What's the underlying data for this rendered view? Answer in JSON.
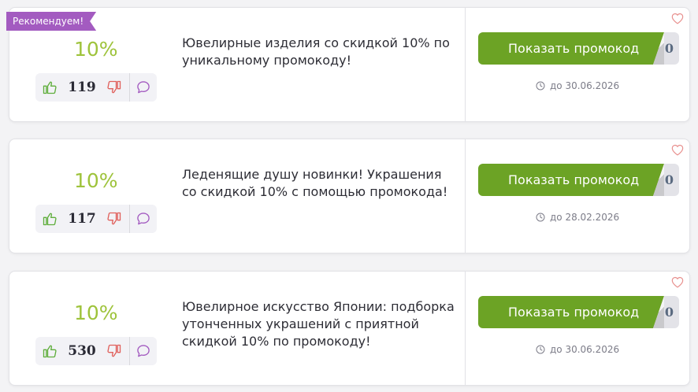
{
  "offers": [
    {
      "badge": "Рекомендуем!",
      "discount": "10%",
      "votes": "119",
      "description": "Ювелирные изделия со скидкой 10% по уникальному промокоду!",
      "button_label": "Показать промокод",
      "uses": "0",
      "expiry": "до 30.06.2026"
    },
    {
      "discount": "10%",
      "votes": "117",
      "description": "Леденящие душу новинки! Украшения со скидкой 10% с помощью промокода!",
      "button_label": "Показать промокод",
      "uses": "0",
      "expiry": "до 28.02.2026"
    },
    {
      "discount": "10%",
      "votes": "530",
      "description": "Ювелирное искусство Японии: подборка утонченных украшений с приятной скидкой 10% по промокоду!",
      "button_label": "Показать промокод",
      "uses": "0",
      "expiry": "до 30.06.2026"
    }
  ],
  "icons": {
    "like": "thumbs-up-icon",
    "dislike": "thumbs-down-icon",
    "comment": "comment-icon",
    "favorite": "heart-icon",
    "clock": "clock-icon"
  },
  "colors": {
    "accent_green": "#6ca325",
    "discount_green": "#9ec33b",
    "badge_purple": "#a35bc0",
    "like_green": "#5fae3c",
    "dislike_red": "#e0605c",
    "comment_purple": "#a35bc0",
    "heart_pink": "#e8918f"
  }
}
